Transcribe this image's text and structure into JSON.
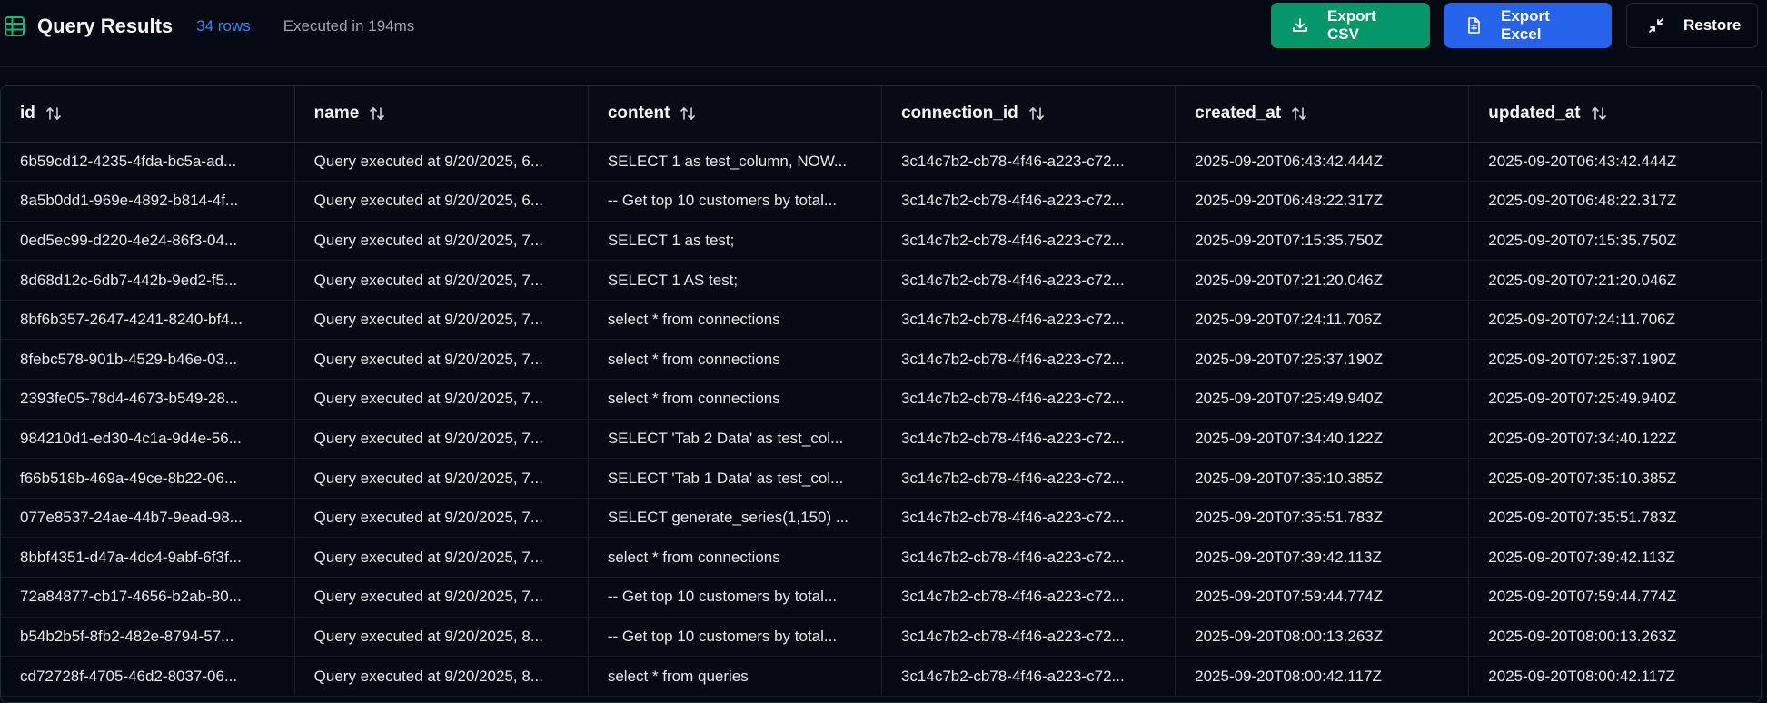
{
  "header": {
    "title": "Query Results",
    "row_count": "34 rows",
    "exec_time": "Executed in 194ms",
    "title_icon": "table-grid-icon"
  },
  "actions": {
    "export_csv": "Export CSV",
    "export_excel": "Export Excel",
    "restore": "Restore"
  },
  "colors": {
    "accent_blue": "#3b82f6",
    "csv_green": "#059669",
    "excel_blue": "#2563eb",
    "background": "#050913"
  },
  "table": {
    "columns": [
      "id",
      "name",
      "content",
      "connection_id",
      "created_at",
      "updated_at"
    ],
    "rows": [
      [
        "6b59cd12-4235-4fda-bc5a-ad...",
        "Query executed at 9/20/2025, 6...",
        "SELECT 1 as test_column, NOW...",
        "3c14c7b2-cb78-4f46-a223-c72...",
        "2025-09-20T06:43:42.444Z",
        "2025-09-20T06:43:42.444Z"
      ],
      [
        "8a5b0dd1-969e-4892-b814-4f...",
        "Query executed at 9/20/2025, 6...",
        "-- Get top 10 customers by total...",
        "3c14c7b2-cb78-4f46-a223-c72...",
        "2025-09-20T06:48:22.317Z",
        "2025-09-20T06:48:22.317Z"
      ],
      [
        "0ed5ec99-d220-4e24-86f3-04...",
        "Query executed at 9/20/2025, 7...",
        "SELECT 1 as test;",
        "3c14c7b2-cb78-4f46-a223-c72...",
        "2025-09-20T07:15:35.750Z",
        "2025-09-20T07:15:35.750Z"
      ],
      [
        "8d68d12c-6db7-442b-9ed2-f5...",
        "Query executed at 9/20/2025, 7...",
        "SELECT 1 AS test;",
        "3c14c7b2-cb78-4f46-a223-c72...",
        "2025-09-20T07:21:20.046Z",
        "2025-09-20T07:21:20.046Z"
      ],
      [
        "8bf6b357-2647-4241-8240-bf4...",
        "Query executed at 9/20/2025, 7...",
        "select * from connections",
        "3c14c7b2-cb78-4f46-a223-c72...",
        "2025-09-20T07:24:11.706Z",
        "2025-09-20T07:24:11.706Z"
      ],
      [
        "8febc578-901b-4529-b46e-03...",
        "Query executed at 9/20/2025, 7...",
        "select * from connections",
        "3c14c7b2-cb78-4f46-a223-c72...",
        "2025-09-20T07:25:37.190Z",
        "2025-09-20T07:25:37.190Z"
      ],
      [
        "2393fe05-78d4-4673-b549-28...",
        "Query executed at 9/20/2025, 7...",
        "select * from connections",
        "3c14c7b2-cb78-4f46-a223-c72...",
        "2025-09-20T07:25:49.940Z",
        "2025-09-20T07:25:49.940Z"
      ],
      [
        "984210d1-ed30-4c1a-9d4e-56...",
        "Query executed at 9/20/2025, 7...",
        "SELECT 'Tab 2 Data' as test_col...",
        "3c14c7b2-cb78-4f46-a223-c72...",
        "2025-09-20T07:34:40.122Z",
        "2025-09-20T07:34:40.122Z"
      ],
      [
        "f66b518b-469a-49ce-8b22-06...",
        "Query executed at 9/20/2025, 7...",
        "SELECT 'Tab 1 Data' as test_col...",
        "3c14c7b2-cb78-4f46-a223-c72...",
        "2025-09-20T07:35:10.385Z",
        "2025-09-20T07:35:10.385Z"
      ],
      [
        "077e8537-24ae-44b7-9ead-98...",
        "Query executed at 9/20/2025, 7...",
        "SELECT generate_series(1,150) ...",
        "3c14c7b2-cb78-4f46-a223-c72...",
        "2025-09-20T07:35:51.783Z",
        "2025-09-20T07:35:51.783Z"
      ],
      [
        "8bbf4351-d47a-4dc4-9abf-6f3f...",
        "Query executed at 9/20/2025, 7...",
        "select * from connections",
        "3c14c7b2-cb78-4f46-a223-c72...",
        "2025-09-20T07:39:42.113Z",
        "2025-09-20T07:39:42.113Z"
      ],
      [
        "72a84877-cb17-4656-b2ab-80...",
        "Query executed at 9/20/2025, 7...",
        "-- Get top 10 customers by total...",
        "3c14c7b2-cb78-4f46-a223-c72...",
        "2025-09-20T07:59:44.774Z",
        "2025-09-20T07:59:44.774Z"
      ],
      [
        "b54b2b5f-8fb2-482e-8794-57...",
        "Query executed at 9/20/2025, 8...",
        "-- Get top 10 customers by total...",
        "3c14c7b2-cb78-4f46-a223-c72...",
        "2025-09-20T08:00:13.263Z",
        "2025-09-20T08:00:13.263Z"
      ],
      [
        "cd72728f-4705-46d2-8037-06...",
        "Query executed at 9/20/2025, 8...",
        "select * from queries",
        "3c14c7b2-cb78-4f46-a223-c72...",
        "2025-09-20T08:00:42.117Z",
        "2025-09-20T08:00:42.117Z"
      ]
    ]
  }
}
